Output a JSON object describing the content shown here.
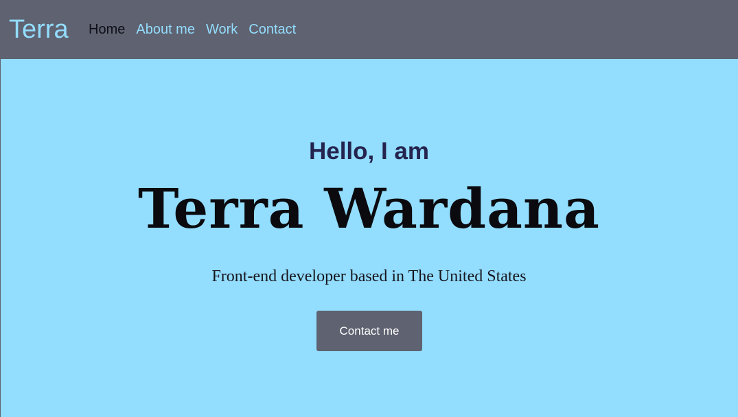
{
  "navbar": {
    "brand": "Terra",
    "links": [
      {
        "label": "Home",
        "active": true
      },
      {
        "label": "About me",
        "active": false
      },
      {
        "label": "Work",
        "active": false
      },
      {
        "label": "Contact",
        "active": false
      }
    ]
  },
  "hero": {
    "greeting": "Hello, I am",
    "name": "Terra Wardana",
    "tagline": "Front-end developer based in The United States",
    "cta_label": "Contact me"
  },
  "colors": {
    "background": "#93ddfe",
    "navbar": "#5f6270",
    "brand": "#93ddfe",
    "greeting": "#24244f",
    "button": "#5f6270"
  }
}
